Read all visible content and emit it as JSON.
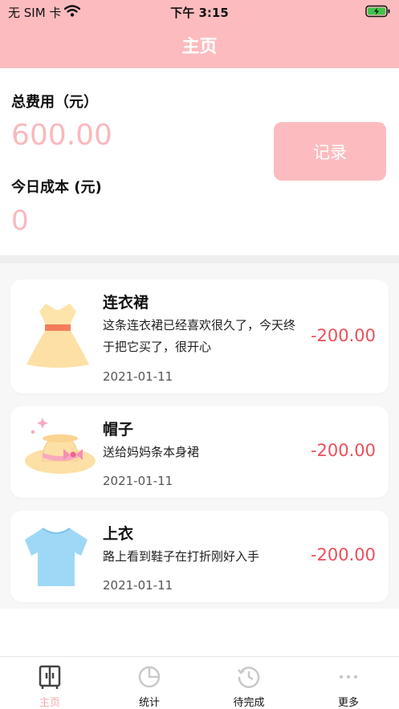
{
  "status_bar": {
    "carrier": "无 SIM 卡",
    "time": "下午 3:15"
  },
  "header": {
    "title": "主页"
  },
  "summary": {
    "total_label": "总费用（元）",
    "total_value": "600.00",
    "today_label": "今日成本 (元)",
    "today_value": "0",
    "record_label": "记录"
  },
  "records": [
    {
      "title": "连衣裙",
      "desc": "这条连衣裙已经喜欢很久了，今天终于把它买了，很开心",
      "date": "2021-01-11",
      "amount": "-200.00",
      "icon": "dress-icon"
    },
    {
      "title": "帽子",
      "desc": "送给妈妈条本身裙",
      "date": "2021-01-11",
      "amount": "-200.00",
      "icon": "hat-icon"
    },
    {
      "title": "上衣",
      "desc": "路上看到鞋子在打折刚好入手",
      "date": "2021-01-11",
      "amount": "-200.00",
      "icon": "tshirt-icon"
    }
  ],
  "tabs": [
    {
      "label": "主页",
      "icon": "wardrobe-icon",
      "active": true
    },
    {
      "label": "统计",
      "icon": "pie-chart-icon",
      "active": false
    },
    {
      "label": "待完成",
      "icon": "history-icon",
      "active": false
    },
    {
      "label": "更多",
      "icon": "more-icon",
      "active": false
    }
  ],
  "colors": {
    "accent": "#fcbcbf",
    "amount": "#ee4f5a",
    "value": "#f9b9bd"
  }
}
